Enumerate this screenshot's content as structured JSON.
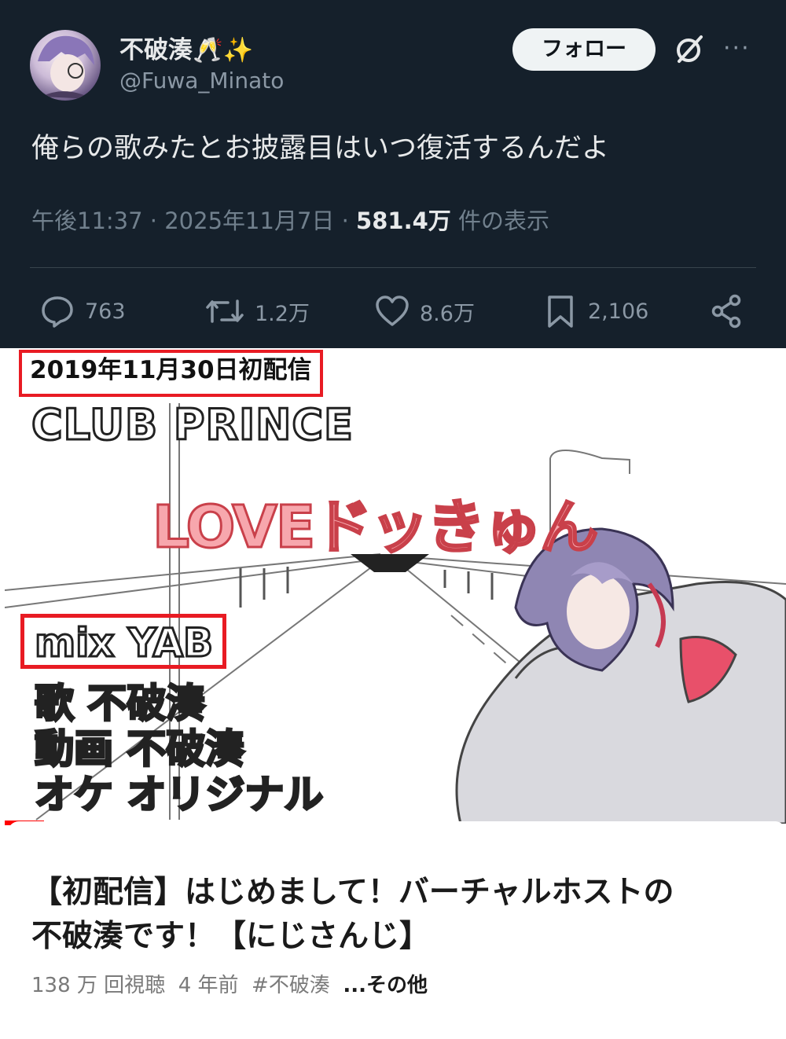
{
  "tweet": {
    "display_name": "不破湊🥂✨",
    "handle": "@Fuwa_Minato",
    "follow_label": "フォロー",
    "more_label": "···",
    "text": "俺らの歌みたとお披露目はいつ復活するんだよ",
    "time": "午後11:37",
    "date": "2025年11月7日",
    "views_count": "581.4万",
    "views_label": "件の表示",
    "separator": " · ",
    "actions": {
      "replies": "763",
      "retweets": "1.2万",
      "likes": "8.6万",
      "bookmarks": "2,106"
    }
  },
  "video": {
    "thumbnail": {
      "date_label": "2019年11月30日初配信",
      "club": "CLUB PRINCE",
      "song": "LOVEドッきゅん",
      "mix": "mix YAB",
      "vocal": "歌 不破湊",
      "movie": "動画 不破湊",
      "oke": "オケ オリジナル",
      "progress": 0.05
    },
    "title_line1": "【初配信】はじめまして！バーチャルホストの",
    "title_line2": "不破湊です！【にじさんじ】",
    "views": "138 万 回視聴",
    "age": "4 年前",
    "tag": "#不破湊",
    "more": "...その他"
  },
  "colors": {
    "tweet_bg": "#15202b",
    "highlight_red": "#e81b23",
    "song_pink": "#f7a7ad",
    "progress_red": "#ff0000"
  }
}
